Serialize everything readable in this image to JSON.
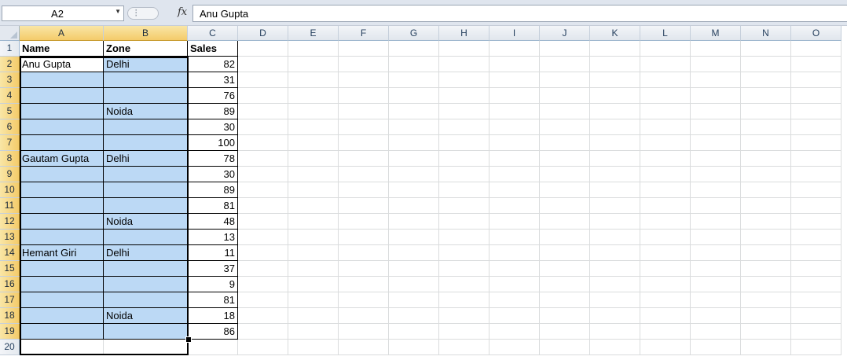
{
  "formula_bar": {
    "name_box": "A2",
    "fx_label": "fx",
    "formula": "Anu Gupta"
  },
  "columns": [
    "A",
    "B",
    "C",
    "D",
    "E",
    "F",
    "G",
    "H",
    "I",
    "J",
    "K",
    "L",
    "M",
    "N",
    "O"
  ],
  "rows": [
    "1",
    "2",
    "3",
    "4",
    "5",
    "6",
    "7",
    "8",
    "9",
    "10",
    "11",
    "12",
    "13",
    "14",
    "15",
    "16",
    "17",
    "18",
    "19",
    "20"
  ],
  "table": {
    "headers": [
      "Name",
      "Zone",
      "Sales"
    ],
    "data": [
      [
        "Anu Gupta",
        "Delhi",
        "82"
      ],
      [
        "",
        "",
        "31"
      ],
      [
        "",
        "",
        "76"
      ],
      [
        "",
        "Noida",
        "89"
      ],
      [
        "",
        "",
        "30"
      ],
      [
        "",
        "",
        "100"
      ],
      [
        "Gautam Gupta",
        "Delhi",
        "78"
      ],
      [
        "",
        "",
        "30"
      ],
      [
        "",
        "",
        "89"
      ],
      [
        "",
        "",
        "81"
      ],
      [
        "",
        "Noida",
        "48"
      ],
      [
        "",
        "",
        "13"
      ],
      [
        "Hemant Giri",
        "Delhi",
        "11"
      ],
      [
        "",
        "",
        "37"
      ],
      [
        "",
        "",
        "9"
      ],
      [
        "",
        "",
        "81"
      ],
      [
        "",
        "Noida",
        "18"
      ],
      [
        "",
        "",
        "86"
      ]
    ]
  },
  "colors": {
    "selection_fill": "#bcd9f5",
    "header_selected": "#f4cb6a"
  }
}
